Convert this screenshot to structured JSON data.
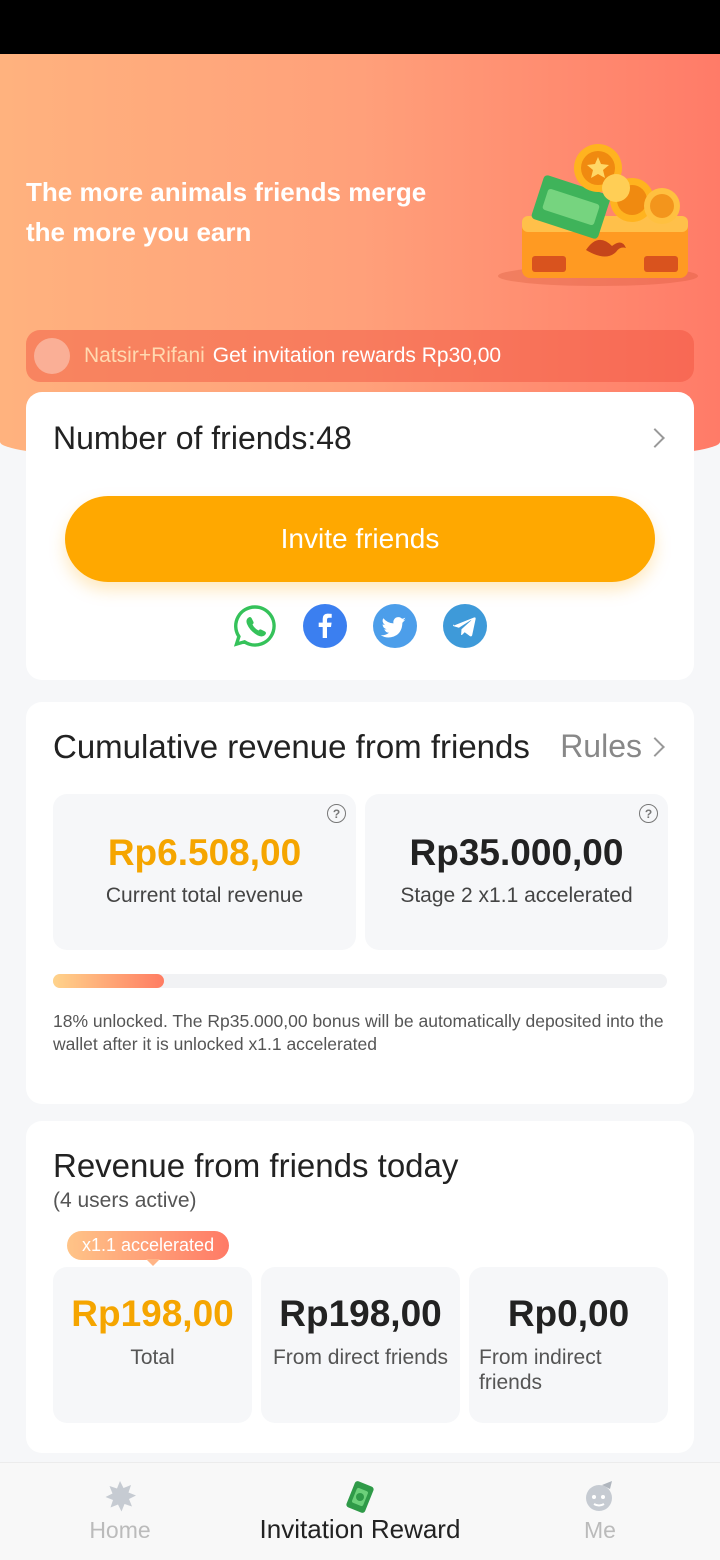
{
  "hero": {
    "title_line1": "The more animals friends merge",
    "title_line2": "the more you earn"
  },
  "ticker": {
    "name": "Natsir+Rifani",
    "message": "Get invitation rewards Rp30,00"
  },
  "friends": {
    "title": "Number of friends:48",
    "invite_label": "Invite friends",
    "share_icons": [
      "whatsapp-icon",
      "facebook-icon",
      "twitter-icon",
      "telegram-icon"
    ]
  },
  "cumulative": {
    "title": "Cumulative revenue from friends",
    "rules_label": "Rules",
    "current_value": "Rp6.508,00",
    "current_label": "Current total revenue",
    "target_value": "Rp35.000,00",
    "target_label": "Stage 2 x1.1 accelerated",
    "progress_fraction": 0.18,
    "note": "18% unlocked. The Rp35.000,00 bonus will be automatically deposited into the wallet after it is unlocked x1.1 accelerated"
  },
  "today": {
    "title": "Revenue from friends today",
    "subtitle": "(4 users active)",
    "badge": "x1.1 accelerated",
    "total_value": "Rp198,00",
    "total_label": "Total",
    "direct_value": "Rp198,00",
    "direct_label": "From direct friends",
    "indirect_value": "Rp0,00",
    "indirect_label": "From indirect friends"
  },
  "tabs": {
    "home": "Home",
    "invitation": "Invitation Reward",
    "me": "Me"
  },
  "colors": {
    "accent": "#ffa800",
    "highlight_value": "#f5a500",
    "hero_start": "#ffb27e",
    "hero_end": "#ff7b68"
  }
}
